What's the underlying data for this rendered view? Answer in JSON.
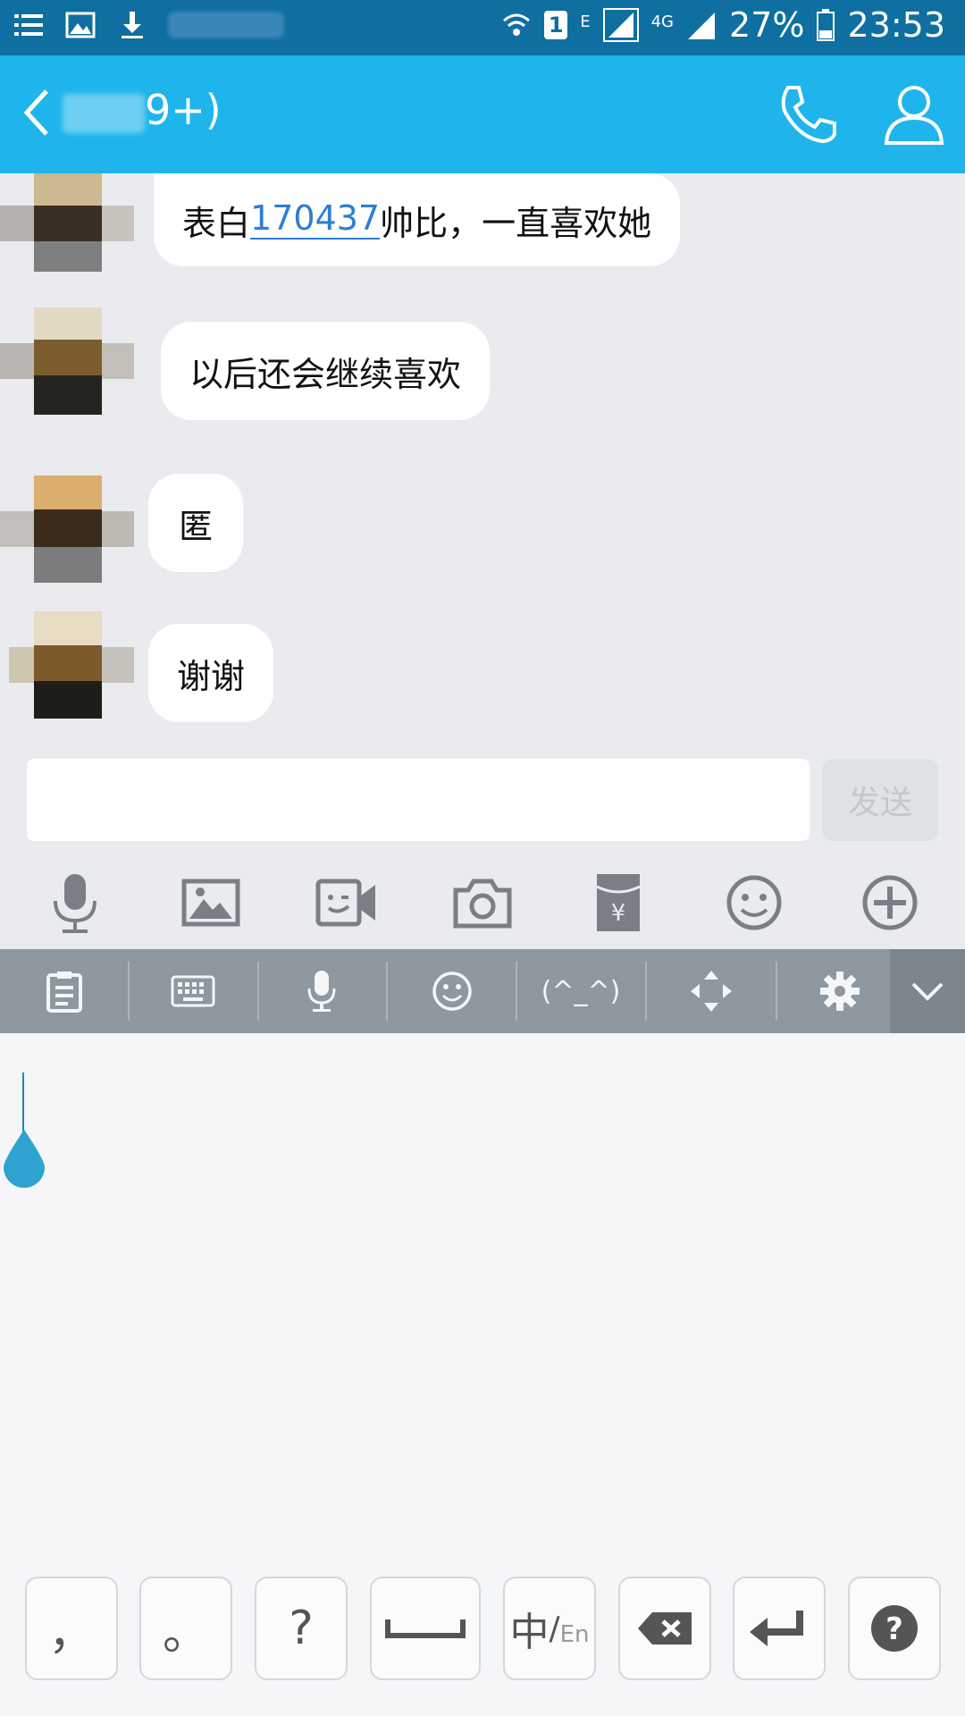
{
  "status_bar": {
    "battery": "27%",
    "time": "23:53",
    "sim_slot": "1",
    "net_e": "E",
    "net_4g": "4G"
  },
  "header": {
    "title_suffix": "9+)"
  },
  "messages": [
    {
      "pre": "表白",
      "link": "170437",
      "post": "帅比，一直喜欢她"
    },
    {
      "text": "以后还会继续喜欢"
    },
    {
      "text": "匿"
    },
    {
      "text": "谢谢"
    }
  ],
  "composer": {
    "input_value": "",
    "send_label": "发送"
  },
  "keyboard": {
    "emoticon_label": "(^_^)",
    "keys": {
      "comma": "，",
      "period": "。",
      "question": "?",
      "lang_zh": "中",
      "lang_en": "En"
    }
  },
  "colors": {
    "status_bar": "#0e6fa0",
    "title_bar": "#1fb5ec",
    "chat_bg": "#e9ebef",
    "link": "#2a7fd4",
    "keyboard_bar": "#8f979f"
  }
}
